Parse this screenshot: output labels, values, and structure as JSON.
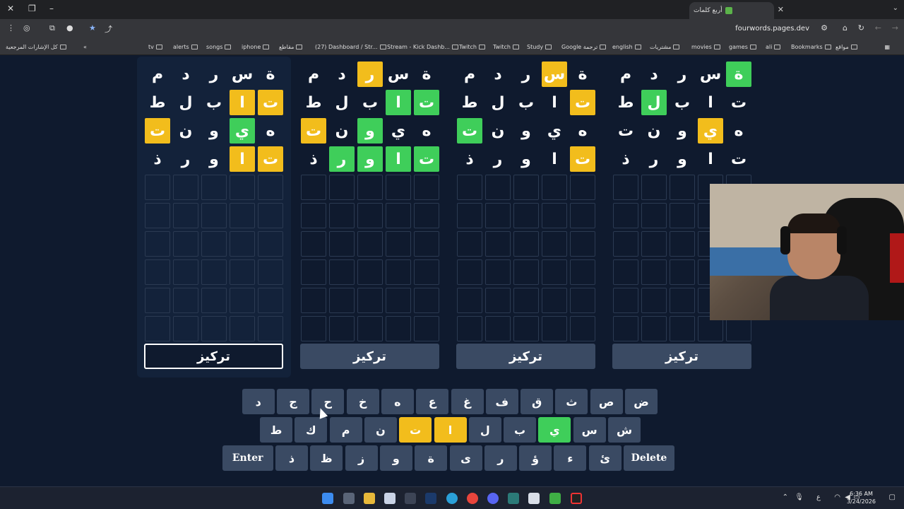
{
  "browser": {
    "tab_title": "أربع كلمات",
    "url": "fourwords.pages.dev",
    "bookmarks_left": [
      "كل الإشارات المرجعية"
    ],
    "bookmarks": [
      "tv",
      "alerts",
      "songs",
      "iphone",
      "مقاطع",
      "(27) Dashboard / Str...",
      "Stream - Kick Dashb...",
      "Twitch",
      "Twitch",
      "Study",
      "Google ترجمة",
      "english",
      "مشتريات",
      "movies",
      "games",
      "ali",
      "Bookmarks",
      "مواقع"
    ]
  },
  "boards": [
    {
      "rows": [
        [
          "ة",
          "س",
          "ر",
          "د",
          "م"
        ],
        [
          "ت",
          "ا",
          "ب",
          "ل",
          "ط"
        ],
        [
          "ه",
          "ي",
          "و",
          "ن",
          "ت"
        ],
        [
          "ت",
          "ا",
          "و",
          "ر",
          "ذ"
        ]
      ],
      "states": [
        [
          "n",
          "n",
          "n",
          "n",
          "n"
        ],
        [
          "y",
          "y",
          "n",
          "n",
          "n"
        ],
        [
          "n",
          "g",
          "n",
          "n",
          "y"
        ],
        [
          "y",
          "y",
          "n",
          "n",
          "n"
        ]
      ],
      "focus_label": "تركيز",
      "active": true
    },
    {
      "rows": [
        [
          "ة",
          "س",
          "ر",
          "د",
          "م"
        ],
        [
          "ت",
          "ا",
          "ب",
          "ل",
          "ط"
        ],
        [
          "ه",
          "ي",
          "و",
          "ن",
          "ت"
        ],
        [
          "ت",
          "ا",
          "و",
          "ر",
          "ذ"
        ]
      ],
      "states": [
        [
          "n",
          "n",
          "y",
          "n",
          "n"
        ],
        [
          "g",
          "g",
          "n",
          "n",
          "n"
        ],
        [
          "n",
          "n",
          "g",
          "n",
          "y"
        ],
        [
          "g",
          "g",
          "g",
          "g",
          "n"
        ]
      ],
      "focus_label": "تركيز",
      "active": false
    },
    {
      "rows": [
        [
          "ة",
          "س",
          "ر",
          "د",
          "م"
        ],
        [
          "ت",
          "ا",
          "ب",
          "ل",
          "ط"
        ],
        [
          "ه",
          "ي",
          "و",
          "ن",
          "ت"
        ],
        [
          "ت",
          "ا",
          "و",
          "ر",
          "ذ"
        ]
      ],
      "states": [
        [
          "n",
          "y",
          "n",
          "n",
          "n"
        ],
        [
          "y",
          "n",
          "n",
          "n",
          "n"
        ],
        [
          "n",
          "n",
          "n",
          "n",
          "g"
        ],
        [
          "y",
          "n",
          "n",
          "n",
          "n"
        ]
      ],
      "focus_label": "تركيز",
      "active": false
    },
    {
      "rows": [
        [
          "ة",
          "س",
          "ر",
          "د",
          "م"
        ],
        [
          "ت",
          "ا",
          "ب",
          "ل",
          "ط"
        ],
        [
          "ه",
          "ي",
          "و",
          "ن",
          "ت"
        ],
        [
          "ت",
          "ا",
          "و",
          "ر",
          "ذ"
        ]
      ],
      "states": [
        [
          "g",
          "n",
          "n",
          "n",
          "n"
        ],
        [
          "n",
          "n",
          "n",
          "g",
          "n"
        ],
        [
          "n",
          "y",
          "n",
          "n",
          "n"
        ],
        [
          "n",
          "n",
          "n",
          "n",
          "n"
        ]
      ],
      "focus_label": "تركيز",
      "active": false
    }
  ],
  "keyboard": {
    "row1": [
      {
        "k": "ض",
        "s": "n"
      },
      {
        "k": "ص",
        "s": "n"
      },
      {
        "k": "ث",
        "s": "n"
      },
      {
        "k": "ق",
        "s": "n"
      },
      {
        "k": "ف",
        "s": "n"
      },
      {
        "k": "غ",
        "s": "n"
      },
      {
        "k": "ع",
        "s": "n"
      },
      {
        "k": "ه",
        "s": "n"
      },
      {
        "k": "خ",
        "s": "n"
      },
      {
        "k": "ح",
        "s": "n"
      },
      {
        "k": "ج",
        "s": "n"
      },
      {
        "k": "د",
        "s": "n"
      }
    ],
    "row2": [
      {
        "k": "ش",
        "s": "n"
      },
      {
        "k": "س",
        "s": "n"
      },
      {
        "k": "ي",
        "s": "g"
      },
      {
        "k": "ب",
        "s": "n"
      },
      {
        "k": "ل",
        "s": "n"
      },
      {
        "k": "ا",
        "s": "y"
      },
      {
        "k": "ت",
        "s": "y"
      },
      {
        "k": "ن",
        "s": "n"
      },
      {
        "k": "م",
        "s": "n"
      },
      {
        "k": "ك",
        "s": "n"
      },
      {
        "k": "ط",
        "s": "n"
      }
    ],
    "row3": [
      {
        "k": "Delete",
        "s": "n"
      },
      {
        "k": "ئ",
        "s": "n"
      },
      {
        "k": "ء",
        "s": "n"
      },
      {
        "k": "ؤ",
        "s": "n"
      },
      {
        "k": "ر",
        "s": "n"
      },
      {
        "k": "ى",
        "s": "n"
      },
      {
        "k": "ة",
        "s": "n"
      },
      {
        "k": "و",
        "s": "n"
      },
      {
        "k": "ز",
        "s": "n"
      },
      {
        "k": "ظ",
        "s": "n"
      },
      {
        "k": "ذ",
        "s": "n"
      },
      {
        "k": "Enter",
        "s": "n"
      }
    ]
  },
  "colors": {
    "yellow": "#f2bd1c",
    "green": "#3fce5a",
    "key": "#3a4a63",
    "bg": "#0f1a2e"
  },
  "taskbar": {
    "time": "6:36 AM",
    "date": "3/24/2026",
    "lang": "ع"
  }
}
